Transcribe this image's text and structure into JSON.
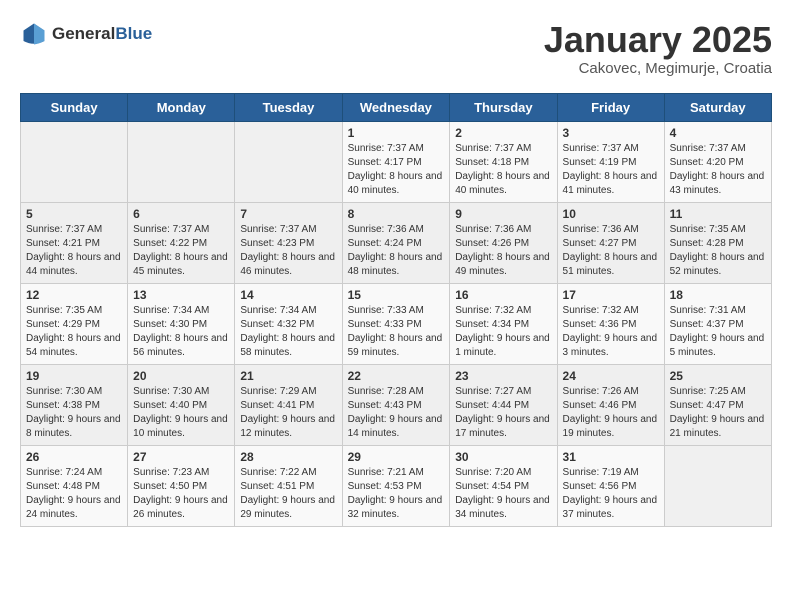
{
  "header": {
    "logo_general": "General",
    "logo_blue": "Blue",
    "title": "January 2025",
    "subtitle": "Cakovec, Megimurje, Croatia"
  },
  "weekdays": [
    "Sunday",
    "Monday",
    "Tuesday",
    "Wednesday",
    "Thursday",
    "Friday",
    "Saturday"
  ],
  "weeks": [
    [
      {
        "day": "",
        "info": ""
      },
      {
        "day": "",
        "info": ""
      },
      {
        "day": "",
        "info": ""
      },
      {
        "day": "1",
        "info": "Sunrise: 7:37 AM\nSunset: 4:17 PM\nDaylight: 8 hours and 40 minutes."
      },
      {
        "day": "2",
        "info": "Sunrise: 7:37 AM\nSunset: 4:18 PM\nDaylight: 8 hours and 40 minutes."
      },
      {
        "day": "3",
        "info": "Sunrise: 7:37 AM\nSunset: 4:19 PM\nDaylight: 8 hours and 41 minutes."
      },
      {
        "day": "4",
        "info": "Sunrise: 7:37 AM\nSunset: 4:20 PM\nDaylight: 8 hours and 43 minutes."
      }
    ],
    [
      {
        "day": "5",
        "info": "Sunrise: 7:37 AM\nSunset: 4:21 PM\nDaylight: 8 hours and 44 minutes."
      },
      {
        "day": "6",
        "info": "Sunrise: 7:37 AM\nSunset: 4:22 PM\nDaylight: 8 hours and 45 minutes."
      },
      {
        "day": "7",
        "info": "Sunrise: 7:37 AM\nSunset: 4:23 PM\nDaylight: 8 hours and 46 minutes."
      },
      {
        "day": "8",
        "info": "Sunrise: 7:36 AM\nSunset: 4:24 PM\nDaylight: 8 hours and 48 minutes."
      },
      {
        "day": "9",
        "info": "Sunrise: 7:36 AM\nSunset: 4:26 PM\nDaylight: 8 hours and 49 minutes."
      },
      {
        "day": "10",
        "info": "Sunrise: 7:36 AM\nSunset: 4:27 PM\nDaylight: 8 hours and 51 minutes."
      },
      {
        "day": "11",
        "info": "Sunrise: 7:35 AM\nSunset: 4:28 PM\nDaylight: 8 hours and 52 minutes."
      }
    ],
    [
      {
        "day": "12",
        "info": "Sunrise: 7:35 AM\nSunset: 4:29 PM\nDaylight: 8 hours and 54 minutes."
      },
      {
        "day": "13",
        "info": "Sunrise: 7:34 AM\nSunset: 4:30 PM\nDaylight: 8 hours and 56 minutes."
      },
      {
        "day": "14",
        "info": "Sunrise: 7:34 AM\nSunset: 4:32 PM\nDaylight: 8 hours and 58 minutes."
      },
      {
        "day": "15",
        "info": "Sunrise: 7:33 AM\nSunset: 4:33 PM\nDaylight: 8 hours and 59 minutes."
      },
      {
        "day": "16",
        "info": "Sunrise: 7:32 AM\nSunset: 4:34 PM\nDaylight: 9 hours and 1 minute."
      },
      {
        "day": "17",
        "info": "Sunrise: 7:32 AM\nSunset: 4:36 PM\nDaylight: 9 hours and 3 minutes."
      },
      {
        "day": "18",
        "info": "Sunrise: 7:31 AM\nSunset: 4:37 PM\nDaylight: 9 hours and 5 minutes."
      }
    ],
    [
      {
        "day": "19",
        "info": "Sunrise: 7:30 AM\nSunset: 4:38 PM\nDaylight: 9 hours and 8 minutes."
      },
      {
        "day": "20",
        "info": "Sunrise: 7:30 AM\nSunset: 4:40 PM\nDaylight: 9 hours and 10 minutes."
      },
      {
        "day": "21",
        "info": "Sunrise: 7:29 AM\nSunset: 4:41 PM\nDaylight: 9 hours and 12 minutes."
      },
      {
        "day": "22",
        "info": "Sunrise: 7:28 AM\nSunset: 4:43 PM\nDaylight: 9 hours and 14 minutes."
      },
      {
        "day": "23",
        "info": "Sunrise: 7:27 AM\nSunset: 4:44 PM\nDaylight: 9 hours and 17 minutes."
      },
      {
        "day": "24",
        "info": "Sunrise: 7:26 AM\nSunset: 4:46 PM\nDaylight: 9 hours and 19 minutes."
      },
      {
        "day": "25",
        "info": "Sunrise: 7:25 AM\nSunset: 4:47 PM\nDaylight: 9 hours and 21 minutes."
      }
    ],
    [
      {
        "day": "26",
        "info": "Sunrise: 7:24 AM\nSunset: 4:48 PM\nDaylight: 9 hours and 24 minutes."
      },
      {
        "day": "27",
        "info": "Sunrise: 7:23 AM\nSunset: 4:50 PM\nDaylight: 9 hours and 26 minutes."
      },
      {
        "day": "28",
        "info": "Sunrise: 7:22 AM\nSunset: 4:51 PM\nDaylight: 9 hours and 29 minutes."
      },
      {
        "day": "29",
        "info": "Sunrise: 7:21 AM\nSunset: 4:53 PM\nDaylight: 9 hours and 32 minutes."
      },
      {
        "day": "30",
        "info": "Sunrise: 7:20 AM\nSunset: 4:54 PM\nDaylight: 9 hours and 34 minutes."
      },
      {
        "day": "31",
        "info": "Sunrise: 7:19 AM\nSunset: 4:56 PM\nDaylight: 9 hours and 37 minutes."
      },
      {
        "day": "",
        "info": ""
      }
    ]
  ]
}
